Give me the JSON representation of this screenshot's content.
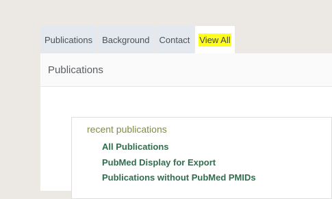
{
  "tabs": [
    {
      "label": "Publications",
      "active": false
    },
    {
      "label": "Background",
      "active": false
    },
    {
      "label": "Contact",
      "active": false
    },
    {
      "label": "View All",
      "active": true,
      "highlight": "#ffff1a"
    }
  ],
  "panel": {
    "title": "Publications",
    "section": {
      "heading": "recent publications",
      "links": [
        {
          "label": "All Publications"
        },
        {
          "label": "PubMed Display for Export"
        },
        {
          "label": "Publications without PubMed PMIDs"
        }
      ]
    }
  },
  "colors": {
    "background": "#ece9e4",
    "tab_inactive": "#e4e9ef",
    "heading": "#7d8f3f",
    "link": "#2f6e4d"
  }
}
